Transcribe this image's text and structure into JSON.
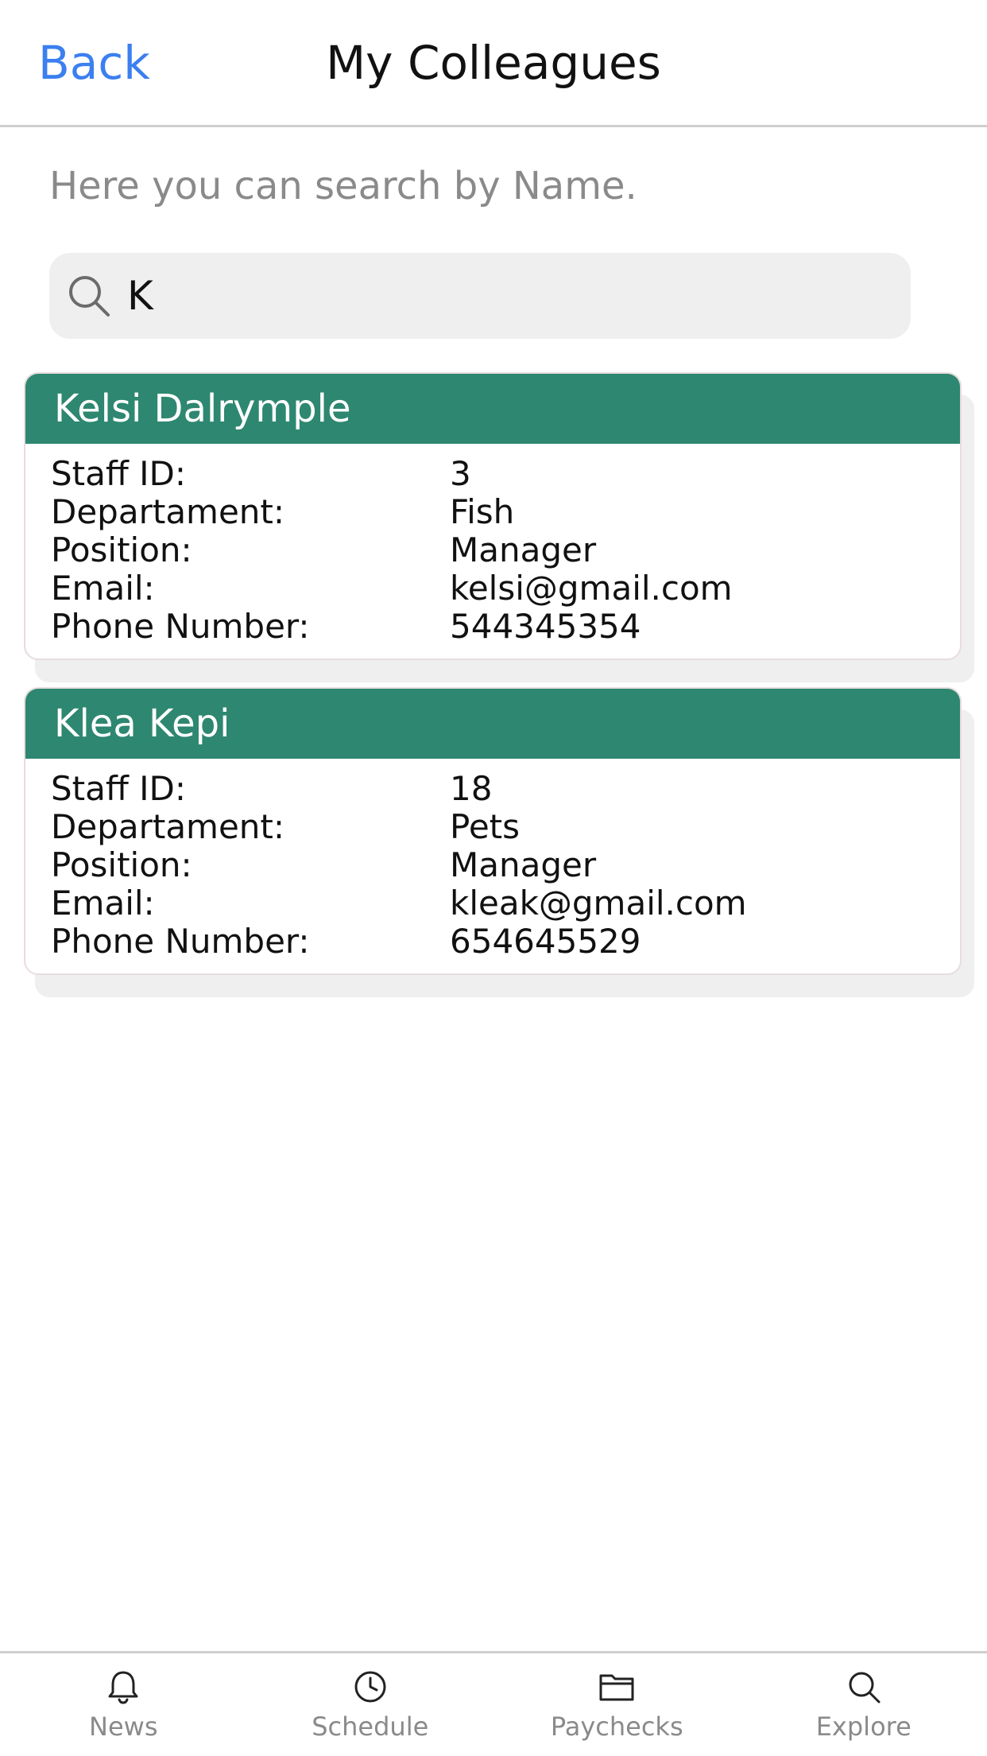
{
  "header": {
    "back_label": "Back",
    "title": "My Colleagues"
  },
  "search": {
    "helper_text": "Here you can search by Name.",
    "value": "K",
    "icon": "search-icon"
  },
  "field_labels": {
    "staff_id": "Staff ID:",
    "department": "Departament:",
    "position": "Position:",
    "email": "Email:",
    "phone": "Phone Number:"
  },
  "colleagues": [
    {
      "name": "Kelsi Dalrymple",
      "staff_id": "3",
      "department": "Fish",
      "position": "Manager",
      "email": "kelsi@gmail.com",
      "phone": "544345354"
    },
    {
      "name": "Klea Kepi",
      "staff_id": "18",
      "department": "Pets",
      "position": "Manager",
      "email": "kleak@gmail.com",
      "phone": "654645529"
    }
  ],
  "nav": {
    "items": [
      {
        "label": "News",
        "icon": "bell-icon"
      },
      {
        "label": "Schedule",
        "icon": "clock-icon"
      },
      {
        "label": "Paychecks",
        "icon": "folder-icon"
      },
      {
        "label": "Explore",
        "icon": "search-icon"
      }
    ]
  },
  "colors": {
    "accent": "#3b7ff0",
    "card_header": "#2e8770",
    "nav_text": "#8a8a8a"
  }
}
